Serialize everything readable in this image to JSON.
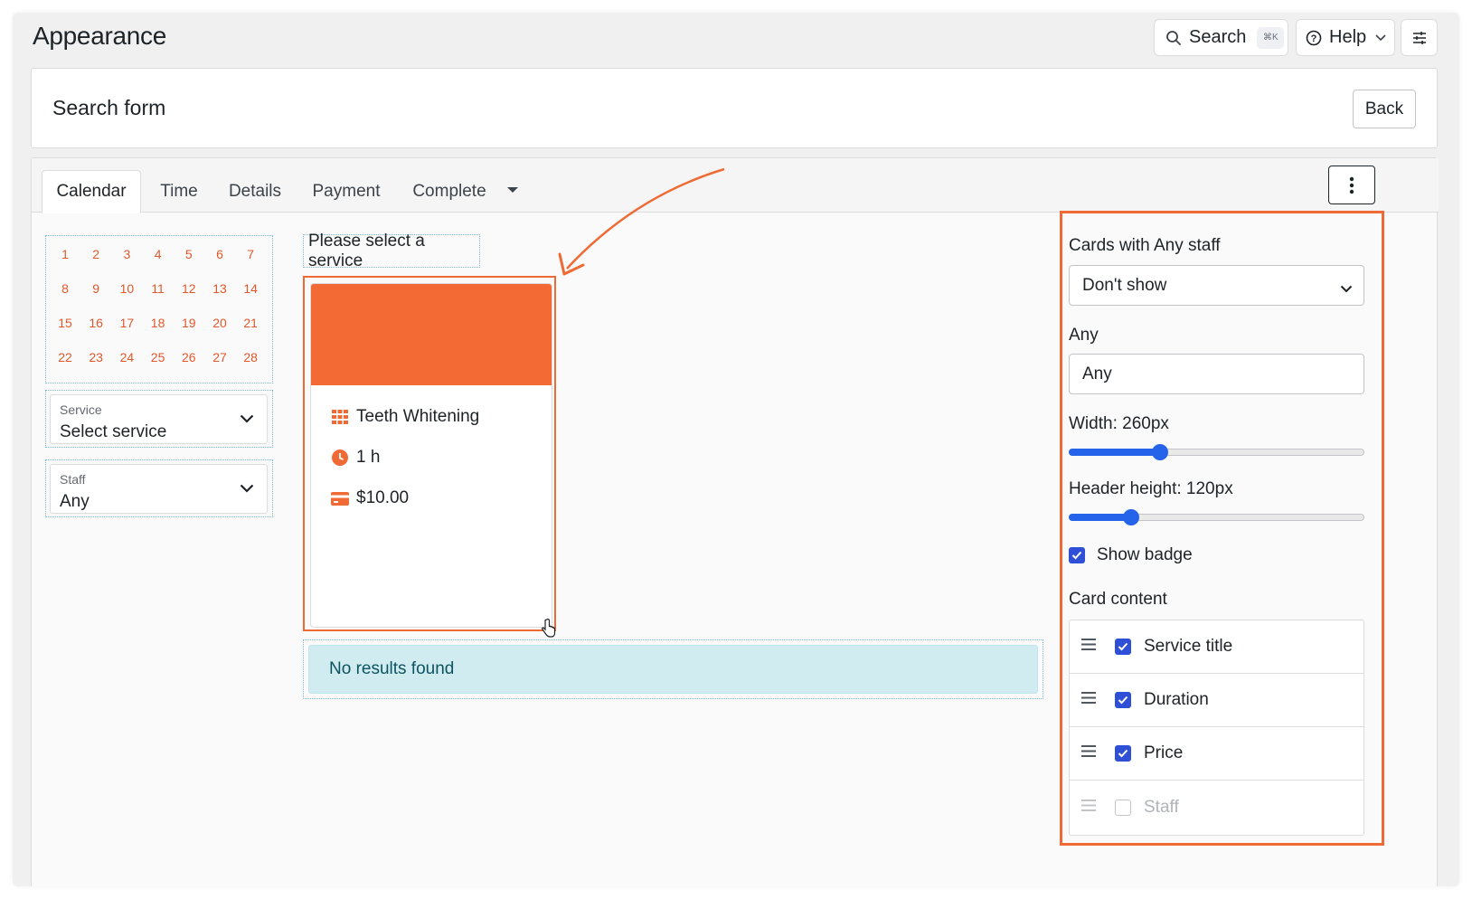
{
  "header": {
    "title": "Appearance",
    "search_label": "Search",
    "search_shortcut": "⌘K",
    "help_label": "Help"
  },
  "form": {
    "title": "Search form",
    "back_label": "Back"
  },
  "tabs": [
    {
      "label": "Calendar",
      "active": true
    },
    {
      "label": "Time"
    },
    {
      "label": "Details"
    },
    {
      "label": "Payment"
    },
    {
      "label": "Complete"
    }
  ],
  "calendar": {
    "days": [
      1,
      2,
      3,
      4,
      5,
      6,
      7,
      8,
      9,
      10,
      11,
      12,
      13,
      14,
      15,
      16,
      17,
      18,
      19,
      20,
      21,
      22,
      23,
      24,
      25,
      26,
      27,
      28
    ],
    "accent": "#e2582a"
  },
  "filters": {
    "service": {
      "label": "Service",
      "value": "Select service"
    },
    "staff": {
      "label": "Staff",
      "value": "Any"
    }
  },
  "preview": {
    "prompt": "Please select a service",
    "card": {
      "header_color": "#f36a34",
      "title": "Teeth Whitening",
      "duration": "1 h",
      "price": "$10.00"
    },
    "no_results": "No results found"
  },
  "settings": {
    "any_staff_label": "Cards with Any staff",
    "any_staff_value": "Don't show",
    "any_label": "Any",
    "any_value": "Any",
    "width_label": "Width: 260px",
    "width_fraction": 0.31,
    "header_height_label": "Header height: 120px",
    "header_height_fraction": 0.21,
    "show_badge_label": "Show badge",
    "show_badge_checked": true,
    "card_content_label": "Card content",
    "card_content": [
      {
        "label": "Service title",
        "checked": true
      },
      {
        "label": "Duration",
        "checked": true
      },
      {
        "label": "Price",
        "checked": true
      },
      {
        "label": "Staff",
        "checked": false
      }
    ]
  },
  "colors": {
    "highlight": "#f06a35",
    "checkbox": "#2f4fd6",
    "slider": "#2563eb"
  }
}
